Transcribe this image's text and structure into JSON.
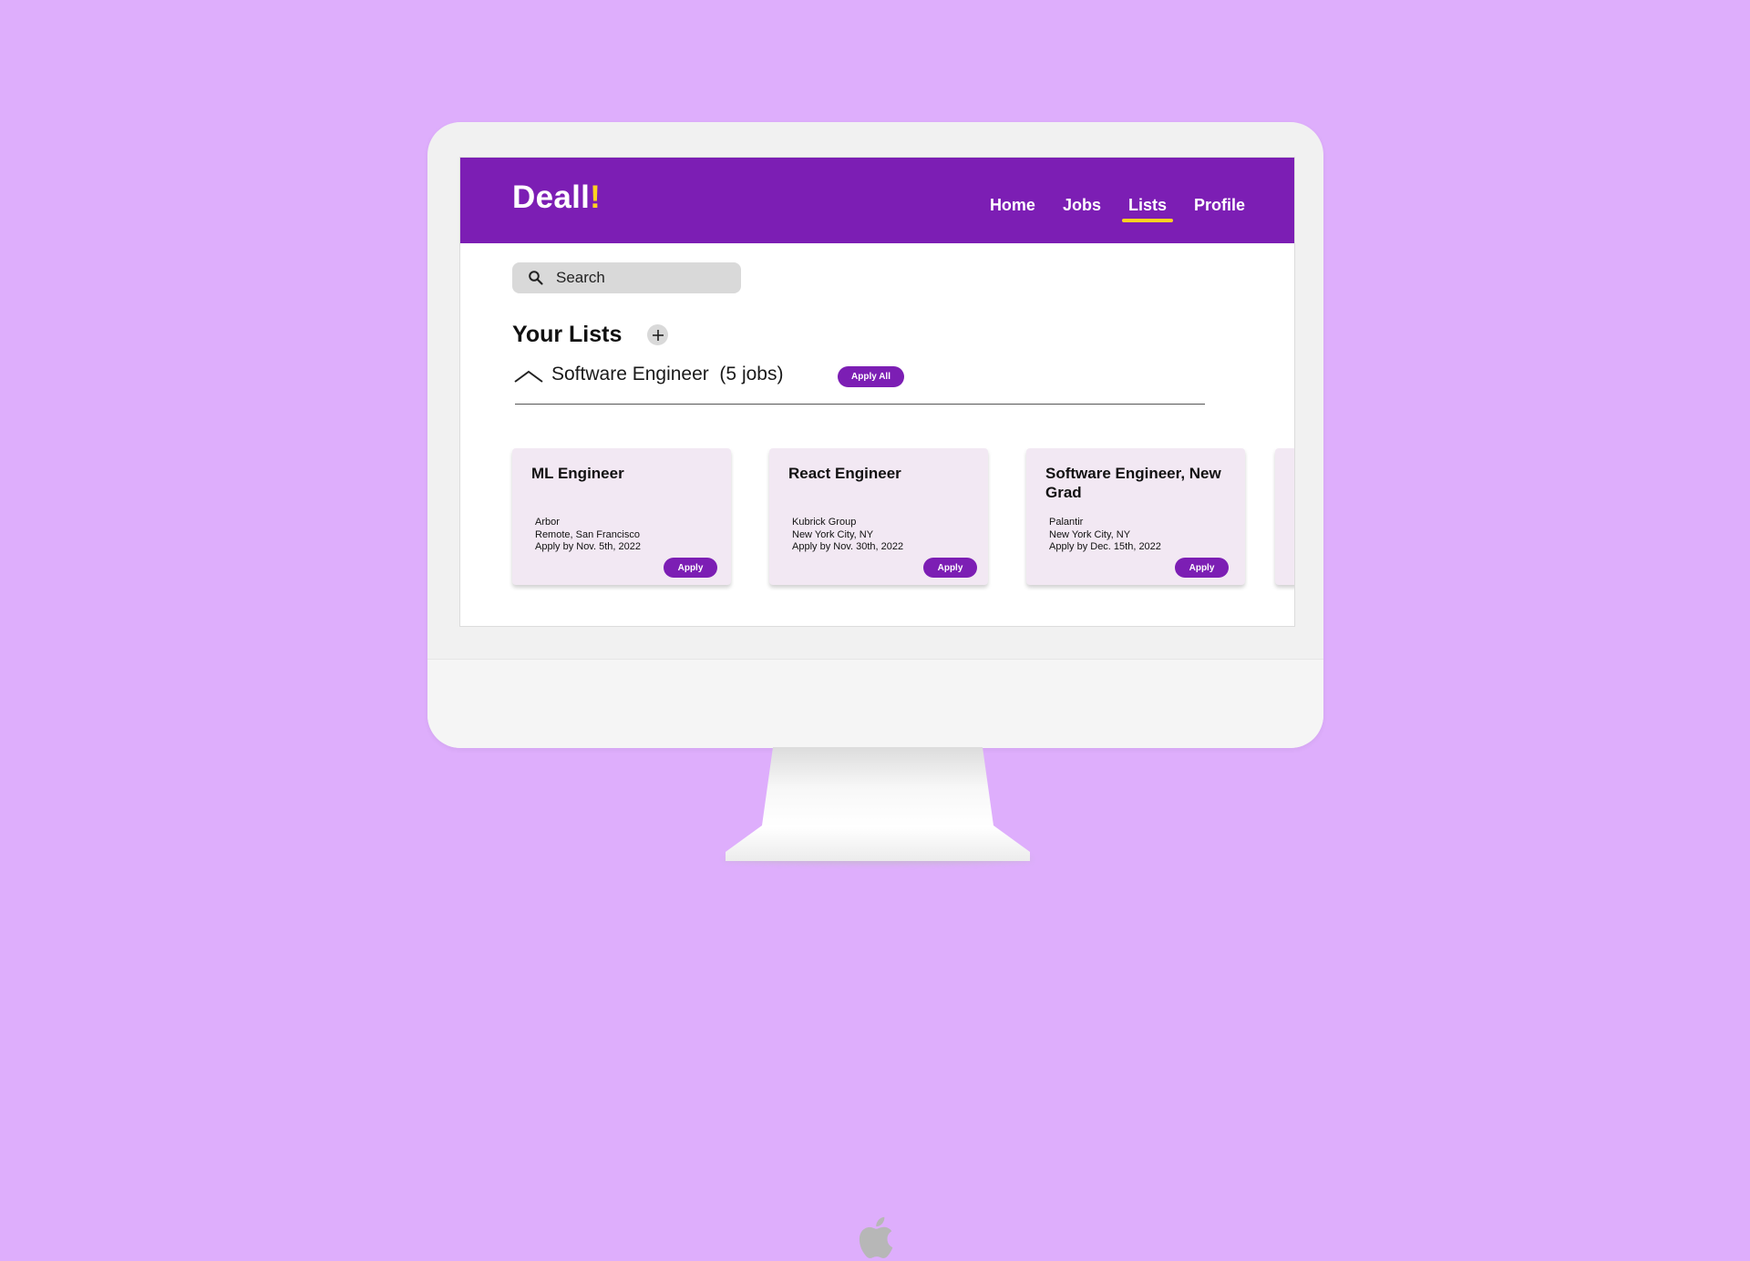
{
  "app": {
    "logo_text": "Deall",
    "logo_accent": "!",
    "brand_color": "#7c1eb4",
    "accent_color": "#ffd21f",
    "background_color": "#deaefc"
  },
  "nav": {
    "items": [
      {
        "label": "Home",
        "active": false
      },
      {
        "label": "Jobs",
        "active": false
      },
      {
        "label": "Lists",
        "active": true
      },
      {
        "label": "Profile",
        "active": false
      }
    ]
  },
  "search": {
    "placeholder": "Search",
    "icon": "search-icon"
  },
  "lists": {
    "title": "Your Lists",
    "add_icon": "plus-icon",
    "current": {
      "name": "Software Engineer  (5 jobs)",
      "expanded": true,
      "apply_all_label": "Apply All"
    }
  },
  "jobs": [
    {
      "title": "ML Engineer",
      "company": "Arbor",
      "location": "Remote, San Francisco",
      "deadline": "Apply by Nov. 5th, 2022",
      "apply_label": "Apply"
    },
    {
      "title": "React Engineer",
      "company": "Kubrick Group",
      "location": "New York City, NY",
      "deadline": "Apply by Nov. 30th, 2022",
      "apply_label": "Apply"
    },
    {
      "title": "Software Engineer, New Grad",
      "company": "Palantir",
      "location": "New York City, NY",
      "deadline": "Apply by Dec. 15th, 2022",
      "apply_label": "Apply"
    }
  ]
}
